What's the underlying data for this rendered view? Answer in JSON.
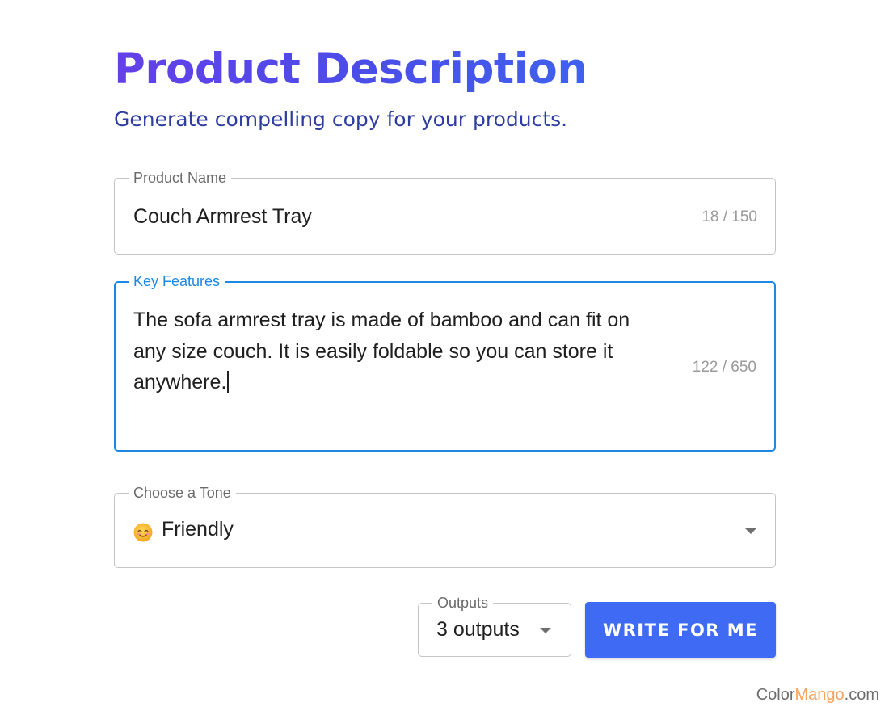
{
  "header": {
    "title": "Product Description",
    "subtitle": "Generate compelling copy for your products."
  },
  "product_name": {
    "label": "Product Name",
    "value": "Couch Armrest Tray",
    "counter": "18 / 150"
  },
  "key_features": {
    "label": "Key Features",
    "value": "The sofa armrest tray is made of bamboo and can fit on any size couch. It is easily foldable so you can store it anywhere.",
    "counter": "122 / 650",
    "focused": true
  },
  "tone": {
    "label": "Choose a Tone",
    "icon": "smiling-face-emoji",
    "value": "Friendly"
  },
  "outputs": {
    "label": "Outputs",
    "value": "3 outputs"
  },
  "actions": {
    "write_label": "WRITE FOR ME"
  },
  "watermark": {
    "part1": "Color",
    "part2": "Mango",
    "part3": ".com"
  },
  "colors": {
    "title_gradient_start": "#6440e8",
    "title_gradient_end": "#3f61ee",
    "subtitle": "#2e3da0",
    "focus_border": "#1e88e5",
    "button_bg": "#3f6af4",
    "watermark_accent": "#f4a25e"
  }
}
